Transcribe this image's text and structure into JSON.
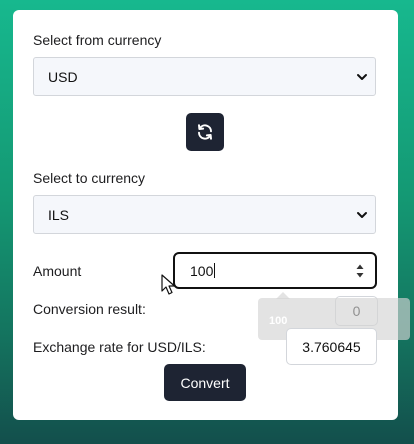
{
  "from": {
    "label": "Select from currency",
    "selected": "USD"
  },
  "swap": {
    "icon": "refresh-icon"
  },
  "to": {
    "label": "Select to currency",
    "selected": "ILS"
  },
  "amount": {
    "label": "Amount",
    "value": "100"
  },
  "tooltip": {
    "text": "100"
  },
  "result": {
    "label": "Conversion result:",
    "value": "0"
  },
  "rate": {
    "label": "Exchange rate for USD/ILS:",
    "value": "3.760645"
  },
  "convert_label": "Convert",
  "colors": {
    "button_bg": "#1e2433",
    "background_top": "#17b88e",
    "background_bottom": "#134f4c"
  }
}
